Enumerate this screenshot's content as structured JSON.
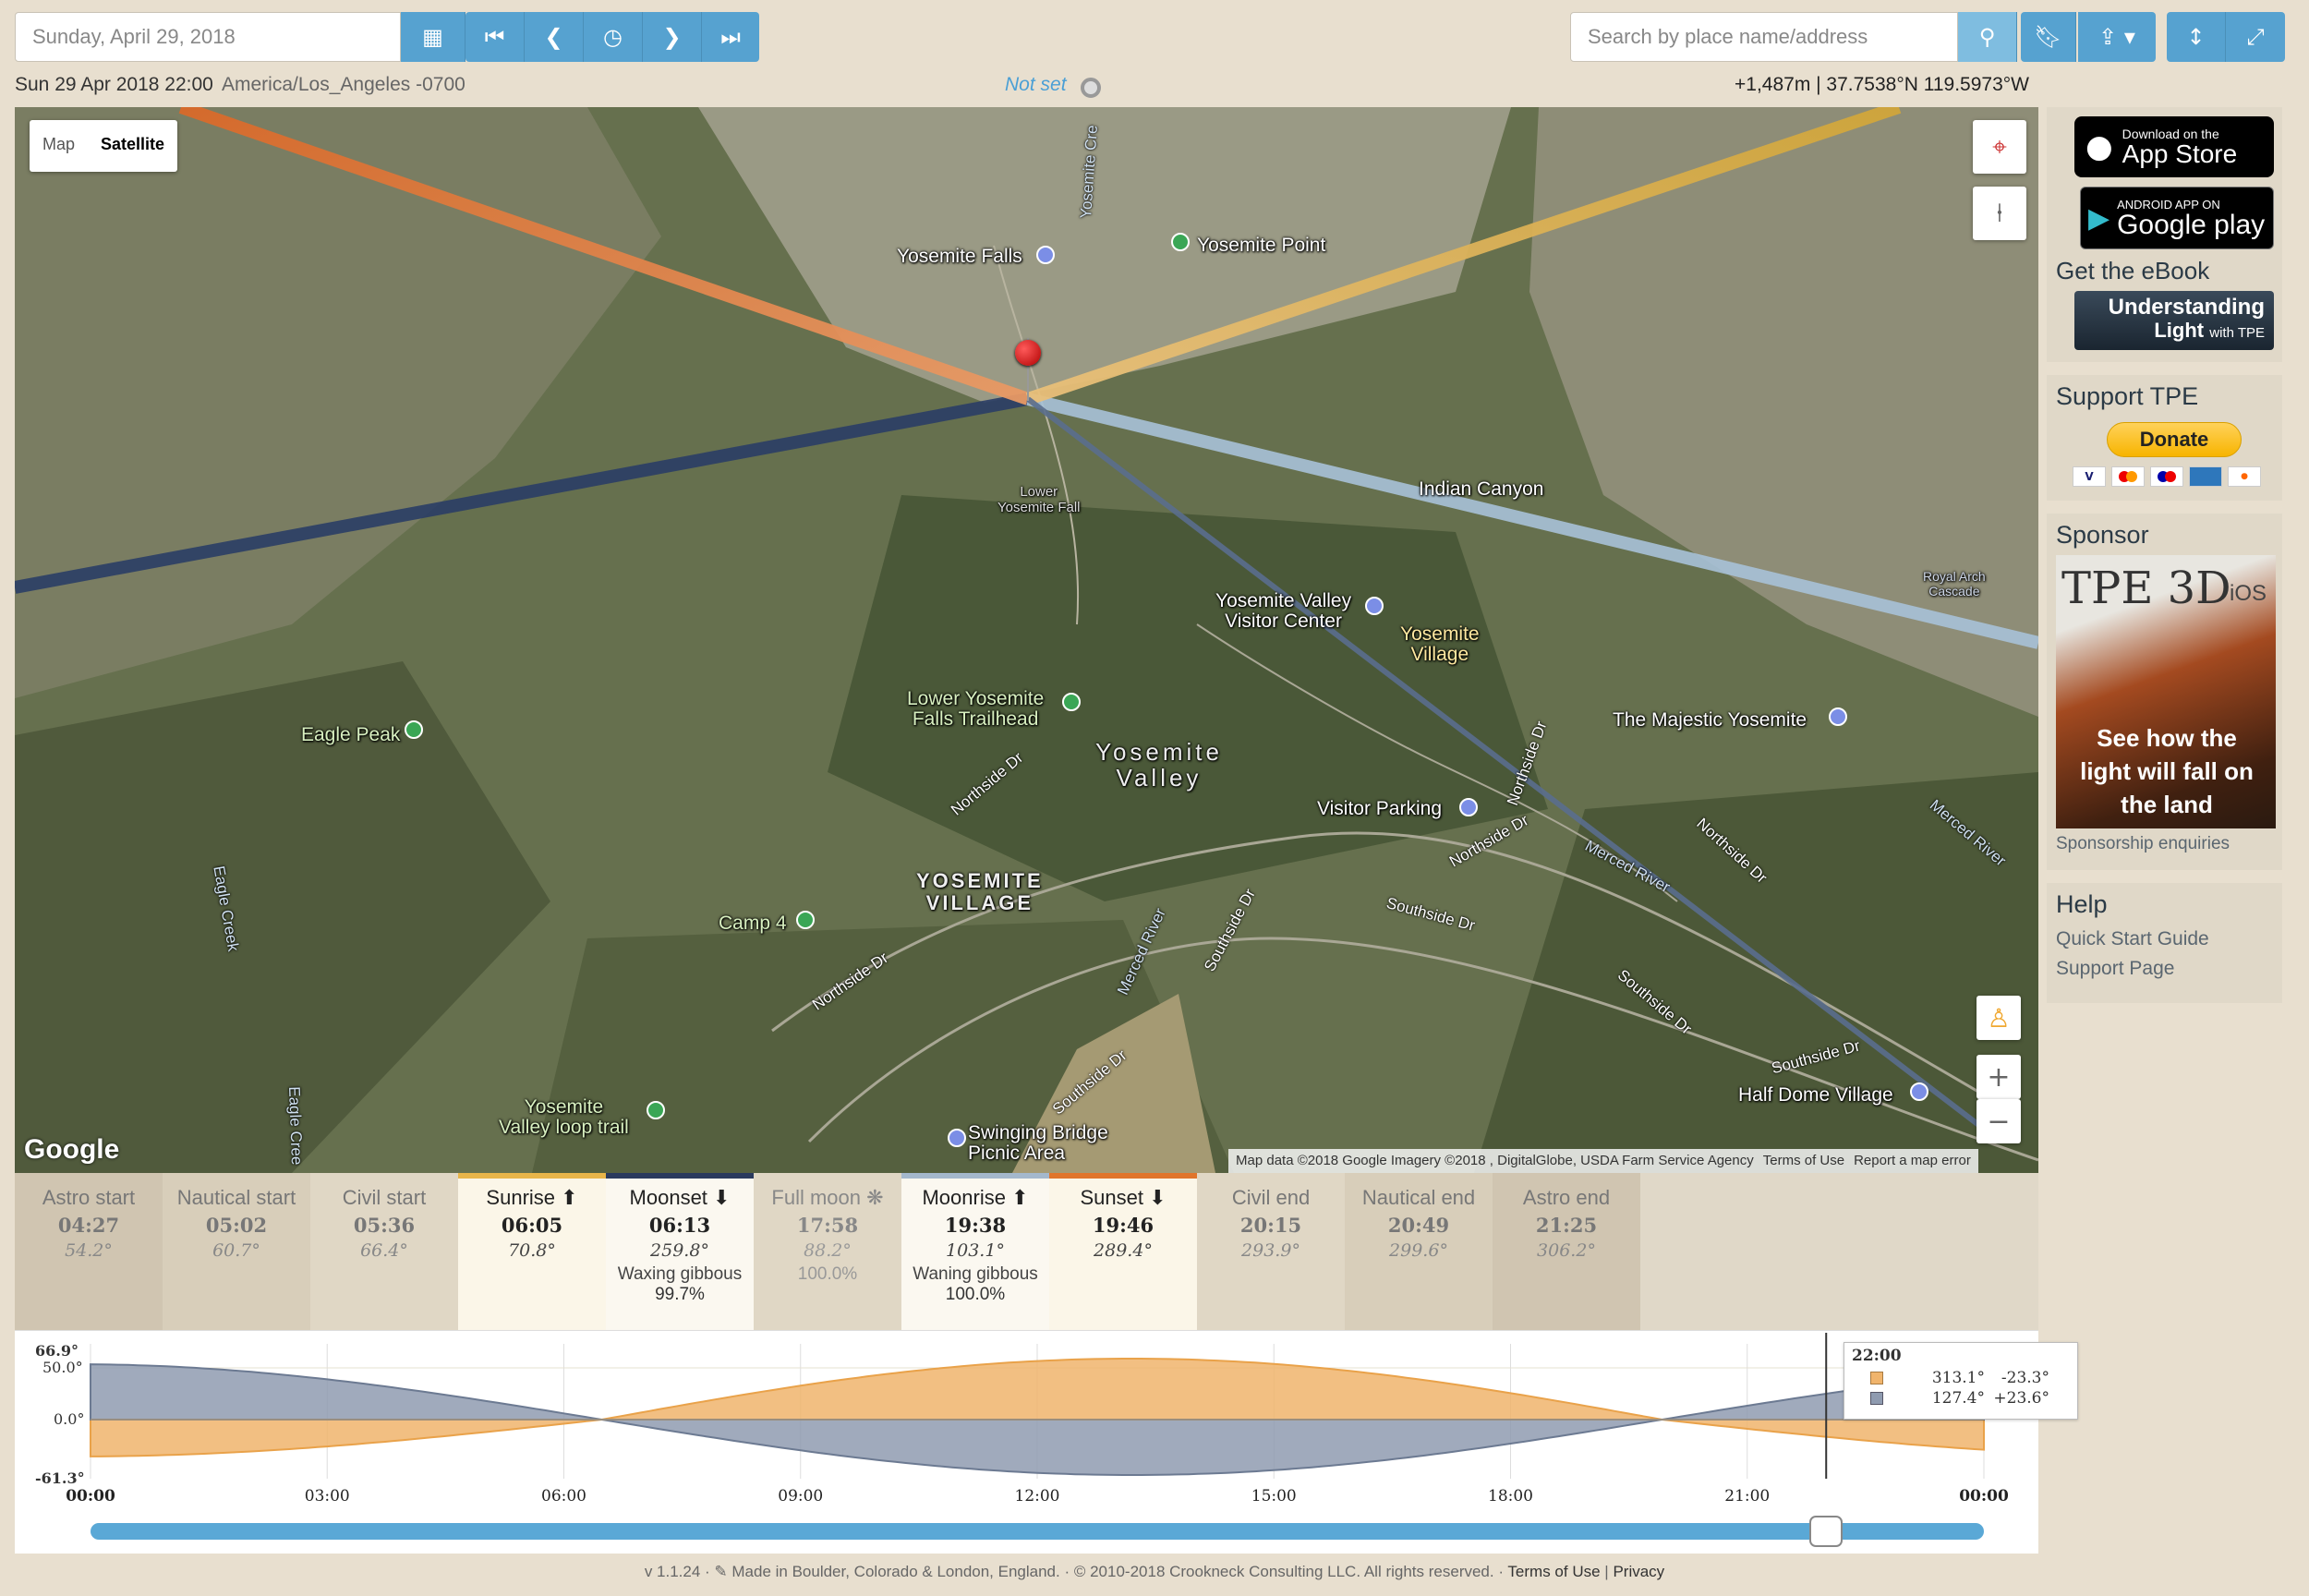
{
  "toolbar": {
    "date_value": "Sunday, April 29, 2018",
    "search_placeholder": "Search by place name/address"
  },
  "info": {
    "datetime": "Sun 29 Apr 2018 22:00",
    "timezone": "America/Los_Angeles -0700",
    "not_set": "Not set",
    "coords": "+1,487m | 37.7538°N 119.5973°W"
  },
  "map": {
    "type_map": "Map",
    "type_satellite": "Satellite",
    "attribution": "Map data ©2018 Google Imagery ©2018 , DigitalGlobe, USDA Farm Service Agency",
    "terms": "Terms of Use",
    "report": "Report a map error",
    "google": "Google",
    "labels": {
      "yosemite_falls": "Yosemite Falls",
      "yosemite_point": "Yosemite Point",
      "lower_fall": "Lower\nYosemite Fall",
      "indian_canyon": "Indian Canyon",
      "royal_arch": "Royal Arch\nCascade",
      "visitor_center": "Yosemite Valley\nVisitor Center",
      "yosemite_village": "Yosemite\nVillage",
      "trailhead": "Lower Yosemite\nFalls Trailhead",
      "eagle_peak": "Eagle Peak",
      "majestic": "The Majestic Yosemite",
      "valley": "Yosemite\nValley",
      "visitor_parking": "Visitor Parking",
      "village_caps": "YOSEMITE\nVILLAGE",
      "camp4": "Camp 4",
      "loop_trail": "Yosemite\nValley loop trail",
      "swinging_bridge": "Swinging Bridge\nPicnic Area",
      "half_dome": "Half Dome Village",
      "eagle_creek": "Eagle Creek",
      "eagle_creek2": "Eagle Cree",
      "yosemite_creek": "Yosemite Cre",
      "merced_river": "Merced River",
      "merced_river2": "Merced River",
      "merced_river3": "Merced River",
      "northside1": "Northside Dr",
      "northside2": "Northside Dr",
      "northside3": "Northside Dr",
      "northside4": "Northside Dr",
      "northside5": "Northside Dr",
      "southside1": "Southside Dr",
      "southside2": "Southside Dr",
      "southside3": "Southside Dr",
      "southside4": "Southside Dr",
      "southside5": "Southside Dr"
    }
  },
  "events": [
    {
      "name": "Astro start",
      "time": "04:27",
      "angle": "54.2°"
    },
    {
      "name": "Nautical start",
      "time": "05:02",
      "angle": "60.7°"
    },
    {
      "name": "Civil start",
      "time": "05:36",
      "angle": "66.4°"
    },
    {
      "name": "Sunrise ⬆",
      "time": "06:05",
      "angle": "70.8°"
    },
    {
      "name": "Moonset ⬇",
      "time": "06:13",
      "angle": "259.8°",
      "phase": "Waxing gibbous",
      "pct": "99.7%"
    },
    {
      "name": "Full moon ❋",
      "time": "17:58",
      "angle": "88.2°",
      "pct": "100.0%"
    },
    {
      "name": "Moonrise ⬆",
      "time": "19:38",
      "angle": "103.1°",
      "phase": "Waning gibbous",
      "pct": "100.0%"
    },
    {
      "name": "Sunset ⬇",
      "time": "19:46",
      "angle": "289.4°"
    },
    {
      "name": "Civil end",
      "time": "20:15",
      "angle": "293.9°"
    },
    {
      "name": "Nautical end",
      "time": "20:49",
      "angle": "299.6°"
    },
    {
      "name": "Astro end",
      "time": "21:25",
      "angle": "306.2°"
    }
  ],
  "chart": {
    "y_labels": {
      "top": "66.9°",
      "fifty": "50.0°",
      "zero": "0.0°",
      "bottom": "-61.3°"
    },
    "x_labels": [
      "00:00",
      "03:00",
      "06:00",
      "09:00",
      "12:00",
      "15:00",
      "18:00",
      "21:00",
      "00:00"
    ],
    "tooltip_time": "22:00",
    "sun_az": "313.1°",
    "sun_alt": "-23.3°",
    "moon_az": "127.4°",
    "moon_alt": "+23.6°",
    "sun_color": "#f0b46c",
    "moon_color": "#8f9bb0",
    "slider_fraction": 0.9167
  },
  "sidebar": {
    "appstore_small": "Download on the",
    "appstore_big": "App Store",
    "gplay_small": "ANDROID APP ON",
    "gplay_big": "Google play",
    "ebook_title": "Get the eBook",
    "ebook_line1": "Understanding",
    "ebook_line2": "Light",
    "ebook_with": "with TPE",
    "support_title": "Support TPE",
    "donate": "Donate",
    "sponsor_title": "Sponsor",
    "ad_title": "TPE 3D",
    "ad_ios": "iOS",
    "ad_text": "See how the light will fall on the land",
    "sponsor_link": "Sponsorship enquiries",
    "help_title": "Help",
    "quick_start": "Quick Start Guide",
    "support_page": "Support Page"
  },
  "footer": {
    "text": "v 1.1.24 · ✎ Made in Boulder, Colorado & London, England. · © 2010-2018 Crookneck Consulting LLC. All rights reserved. · ",
    "terms": "Terms of Use",
    "sep": " | ",
    "privacy": "Privacy"
  }
}
